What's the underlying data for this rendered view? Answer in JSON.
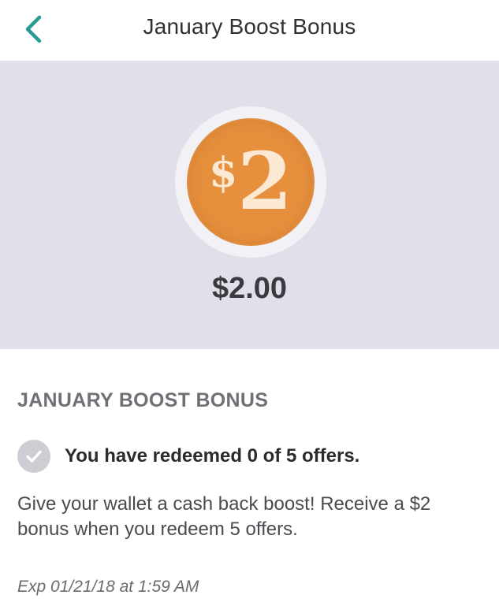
{
  "header": {
    "title": "January Boost Bonus",
    "back_icon": "chevron-left-icon",
    "accent_color": "#2a9a95"
  },
  "hero": {
    "badge": {
      "dollar_sign": "$",
      "number": "2",
      "coin_color": "#e68f3d"
    },
    "amount": "$2.00",
    "background_color": "#e0e0ea"
  },
  "offer": {
    "heading": "JANUARY BOOST BONUS",
    "progress_text": "You have redeemed 0 of 5 offers.",
    "progress_redeemed": 0,
    "progress_total": 5,
    "description": "Give your wallet a cash back boost! Receive a $2 bonus when you redeem 5 offers.",
    "expiry": "Exp 01/21/18 at 1:59 AM"
  }
}
